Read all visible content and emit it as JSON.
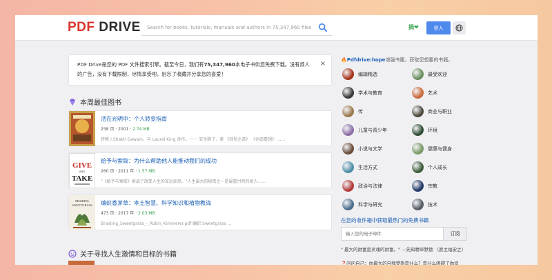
{
  "header": {
    "logo_pdf": "PDF",
    "logo_drive": "DRIVE",
    "search_placeholder": "Search for books, tutorials, manuals and authors in 75,347,960 files",
    "hope_badge": "捐❤",
    "login_label": "登入"
  },
  "notice": {
    "text_part1": "PDF Drive是您的 PDF 文件搜索引擎。截至今日，我们有",
    "count": "75,347,960",
    "text_part2": "本电子书供您免费下载。没有烦人的广告，没有下载限制，尽情享受吧，别忘了收藏并分享您的喜爱！",
    "close": "×"
  },
  "sections": {
    "weekly_top": "本周最佳图书",
    "passion": "关于寻找人生激情和目标的书籍"
  },
  "books": [
    {
      "title": "活在光明中：个人转变指南",
      "pages": "258 页",
      "year": "2001",
      "size": "2.74 MB",
      "desc": "转帮 / Shakti Gawain，与 Laurel King 合作。一一 安全购了、美 《轻型之道》 《创造看想》 ......"
    },
    {
      "title": "给予与索取：为什么帮助他人能推动我们的成功",
      "pages": "260 页",
      "year": "2011 年",
      "size": "1.57 MB",
      "desc": "\"《给予与索取》挑战了改变人生的深远反思。\"人生最大的秘密之一是最重付然的给人......"
    },
    {
      "title": "编织香茅草：本土智慧、科学知识和植物教诲",
      "pages": "473 页",
      "year": "2017 年",
      "size": "2.03 MB",
      "desc": "Braiding_Sweetgrass_-_Robin_Kimmerer.pdf 编织 Sweetgrass ..."
    }
  ],
  "sidebar": {
    "hope_link": "Pdfdrive:hope",
    "hope_text": "增强书籍，获取您想要的书籍。",
    "categories": [
      {
        "label": "编辑精选",
        "color": "#a5341e"
      },
      {
        "label": "最受欢迎",
        "color": "#6b8f5e"
      },
      {
        "label": "学术与教育",
        "color": "#3a3a3a"
      },
      {
        "label": "艺术",
        "color": "#c96a3b"
      },
      {
        "label": "传",
        "color": "#9b7a4e"
      },
      {
        "label": "商业与职业",
        "color": "#4d4a3e"
      },
      {
        "label": "儿童与青少年",
        "color": "#8c6fa8"
      },
      {
        "label": "环境",
        "color": "#2f4d33"
      },
      {
        "label": "小说与文学",
        "color": "#6a4e3a"
      },
      {
        "label": "健康与健身",
        "color": "#7a9a6a"
      },
      {
        "label": "生活方式",
        "color": "#4e8fa8"
      },
      {
        "label": "个人成长",
        "color": "#3d5d3a"
      },
      {
        "label": "政治与法律",
        "color": "#b23a3a"
      },
      {
        "label": "宗教",
        "color": "#233a6a"
      },
      {
        "label": "科学与研究",
        "color": "#4a6e8c"
      },
      {
        "label": "技术",
        "color": "#555a66"
      }
    ],
    "email_title": "在您的收件箱中获取最热门的免费书籍",
    "email_placeholder": "输入您的电子邮件",
    "subscribe_label": "订阅",
    "quote": "\" 最大的财富是灵魂的财富。\" —先知穆罕默德 （愿主福安之）",
    "ask": "❓问问自己：你最大的自我梦想是什么？是什么阻碍了你追"
  }
}
